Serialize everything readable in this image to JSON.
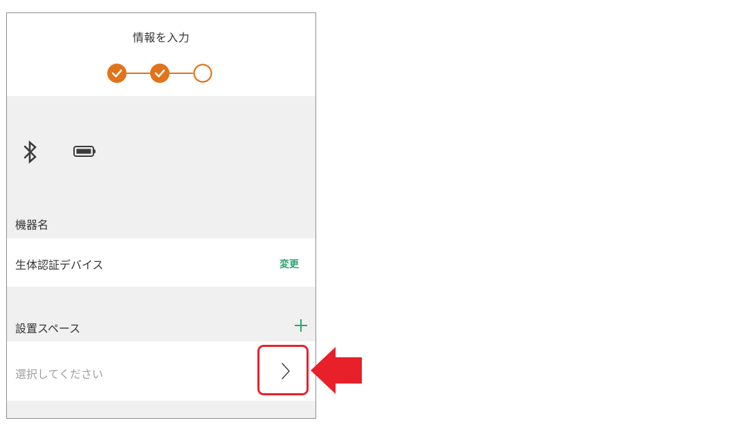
{
  "header": {
    "title": "情報を入力",
    "steps": [
      {
        "state": "complete"
      },
      {
        "state": "complete"
      },
      {
        "state": "current"
      }
    ],
    "accent_color": "#e1731a"
  },
  "device": {
    "icons": [
      "bluetooth-icon",
      "battery-icon"
    ]
  },
  "device_name": {
    "section_label": "機器名",
    "value": "生体認証デバイス",
    "change_label": "変更",
    "link_color": "#2aa572"
  },
  "install_space": {
    "section_label": "設置スペース",
    "add_icon": "plus-icon",
    "placeholder": "選択してください",
    "chevron_icon": "chevron-right-icon"
  },
  "annotation": {
    "highlight_color": "#e8202a"
  }
}
